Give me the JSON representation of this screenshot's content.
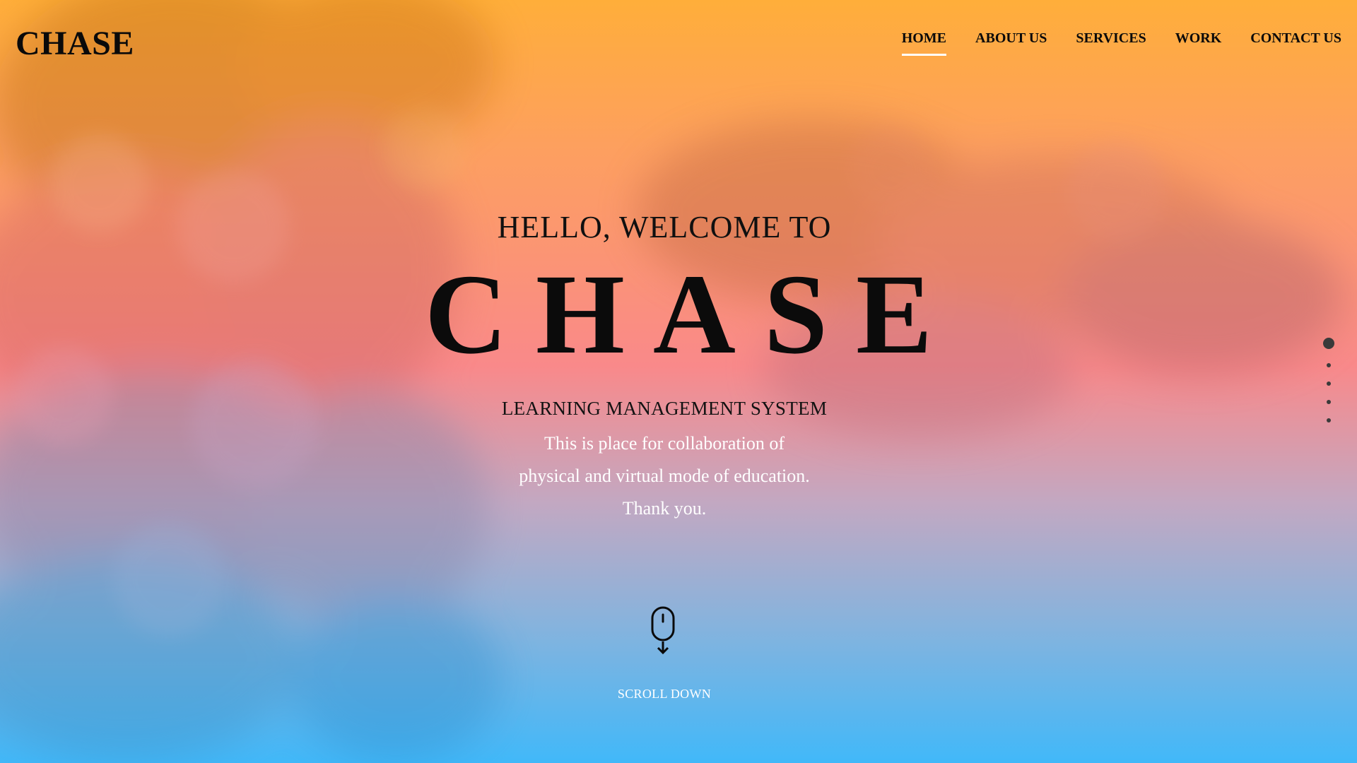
{
  "header": {
    "logo": "CHASE",
    "nav": [
      {
        "label": "HOME",
        "active": true
      },
      {
        "label": "ABOUT US",
        "active": false
      },
      {
        "label": "SERVICES",
        "active": false
      },
      {
        "label": "WORK",
        "active": false
      },
      {
        "label": "CONTACT US",
        "active": false
      }
    ]
  },
  "hero": {
    "welcome": "HELLO, WELCOME TO",
    "title": "CHASE",
    "subtitle": "LEARNING MANAGEMENT SYSTEM",
    "description": [
      "This is place for collaboration of",
      "physical and virtual mode of education.",
      "Thank you."
    ]
  },
  "scroll": {
    "label": "SCROLL DOWN",
    "icon": "mouse-scroll-icon"
  },
  "pagination": {
    "total": 5,
    "active_index": 0
  },
  "colors": {
    "top": "#ffae3a",
    "middle": "#f9898a",
    "bottom": "#41b8f9",
    "nav_active_underline": "#ffffff"
  }
}
